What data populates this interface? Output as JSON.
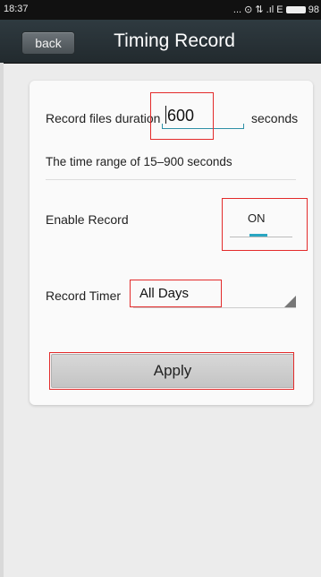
{
  "status_bar": {
    "time": "18:37",
    "icons": "... ⊙ ⇅ .ıl E",
    "battery_text": "98"
  },
  "header": {
    "back_label": "back",
    "title": "Timing Record"
  },
  "form": {
    "duration_label": "Record files duration",
    "duration_value": "600",
    "duration_unit": "seconds",
    "range_hint": "The time range of 15–900 seconds",
    "enable_label": "Enable Record",
    "enable_value": "ON",
    "timer_label": "Record Timer",
    "timer_value": "All Days",
    "apply_label": "Apply"
  },
  "colors": {
    "accent": "#2aa6c2",
    "highlight": "#e32b2b",
    "header_bg": "#2a3338"
  }
}
